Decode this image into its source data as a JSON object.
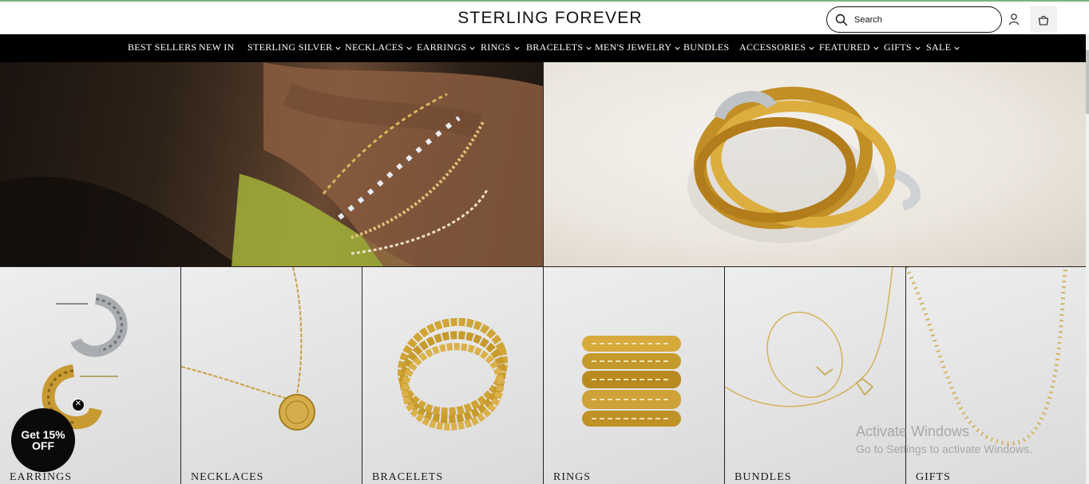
{
  "header": {
    "brand": "STERLING FOREVER",
    "search_placeholder": "Search"
  },
  "nav": {
    "items": [
      {
        "label": "BEST SELLERS",
        "dropdown": false
      },
      {
        "label": "NEW IN",
        "dropdown": false
      },
      {
        "label": "STERLING SILVER",
        "dropdown": true
      },
      {
        "label": "NECKLACES",
        "dropdown": true
      },
      {
        "label": "EARRINGS",
        "dropdown": true
      },
      {
        "label": "RINGS",
        "dropdown": true
      },
      {
        "label": "BRACELETS",
        "dropdown": true
      },
      {
        "label": "MEN'S JEWELRY",
        "dropdown": true
      },
      {
        "label": "BUNDLES",
        "dropdown": false
      },
      {
        "label": "ACCESSORIES",
        "dropdown": true
      },
      {
        "label": "FEATURED",
        "dropdown": true
      },
      {
        "label": "GIFTS",
        "dropdown": true
      },
      {
        "label": "SALE",
        "dropdown": true
      }
    ]
  },
  "categories": [
    {
      "label": "EARRINGS"
    },
    {
      "label": "NECKLACES"
    },
    {
      "label": "BRACELETS"
    },
    {
      "label": "RINGS"
    },
    {
      "label": "BUNDLES"
    },
    {
      "label": "GIFTS"
    }
  ],
  "promo": {
    "line1": "Get 15%",
    "line2": "OFF",
    "close": "✕"
  },
  "watermark": {
    "title": "Activate Windows",
    "subtitle": "Go to Settings to activate Windows."
  },
  "colors": {
    "nav_bg": "#000000",
    "gold": "#c9a23a",
    "text": "#111111"
  }
}
